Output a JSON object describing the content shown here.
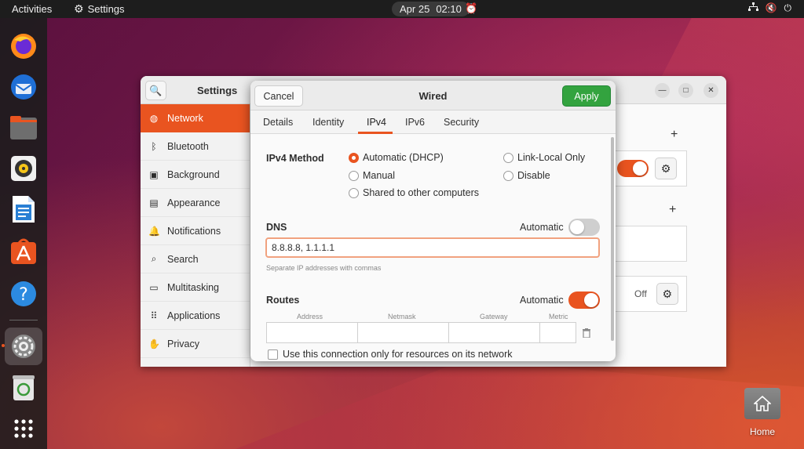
{
  "topbar": {
    "activities": "Activities",
    "app_name": "Settings",
    "date": "Apr 25",
    "time": "02:10"
  },
  "dock": {
    "items": [
      "firefox",
      "thunderbird",
      "files",
      "rhythmbox",
      "libreoffice-writer",
      "app-center",
      "help",
      "settings",
      "trash",
      "show-apps"
    ]
  },
  "settings_window": {
    "title": "Settings",
    "sidebar": [
      {
        "label": "Network",
        "icon": "network-icon"
      },
      {
        "label": "Bluetooth",
        "icon": "bluetooth-icon"
      },
      {
        "label": "Background",
        "icon": "background-icon"
      },
      {
        "label": "Appearance",
        "icon": "appearance-icon"
      },
      {
        "label": "Notifications",
        "icon": "bell-icon"
      },
      {
        "label": "Search",
        "icon": "search-icon"
      },
      {
        "label": "Multitasking",
        "icon": "multitasking-icon"
      },
      {
        "label": "Applications",
        "icon": "apps-grid-icon"
      },
      {
        "label": "Privacy",
        "icon": "hand-icon"
      }
    ],
    "vpn_status": "Off"
  },
  "dialog": {
    "title": "Wired",
    "cancel": "Cancel",
    "apply": "Apply",
    "tabs": [
      "Details",
      "Identity",
      "IPv4",
      "IPv6",
      "Security"
    ],
    "active_tab": "IPv4",
    "ipv4_method_label": "IPv4 Method",
    "methods": {
      "automatic": "Automatic (DHCP)",
      "manual": "Manual",
      "shared": "Shared to other computers",
      "link_local": "Link-Local Only",
      "disable": "Disable"
    },
    "selected_method": "Automatic (DHCP)",
    "dns_label": "DNS",
    "dns_automatic_label": "Automatic",
    "dns_automatic": false,
    "dns_value": "8.8.8.8, 1.1.1.1",
    "dns_hint": "Separate IP addresses with commas",
    "routes_label": "Routes",
    "routes_automatic_label": "Automatic",
    "routes_automatic": true,
    "route_columns": [
      "Address",
      "Netmask",
      "Gateway",
      "Metric"
    ],
    "only_resources_label": "Use this connection only for resources on its network"
  },
  "desktop": {
    "home_label": "Home"
  },
  "colors": {
    "accent": "#e95420",
    "apply": "#33a33f"
  }
}
